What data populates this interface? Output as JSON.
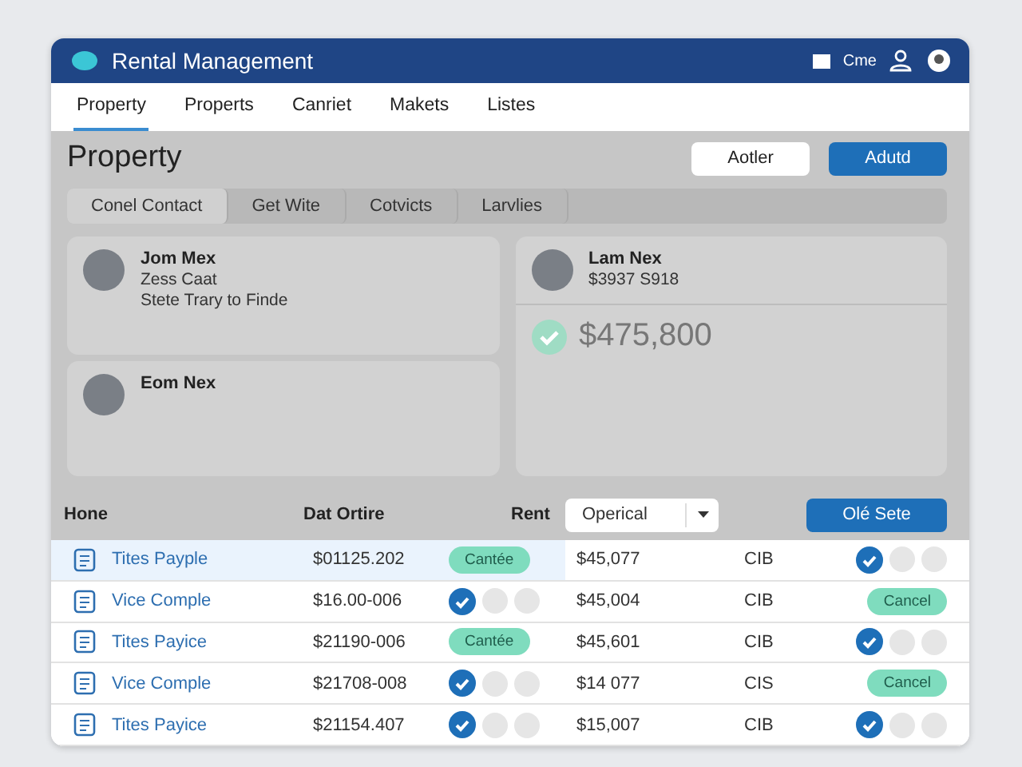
{
  "app": {
    "title": "Rental Management",
    "user_label": "Cme"
  },
  "nav": [
    {
      "label": "Property",
      "selected": true
    },
    {
      "label": "Properts",
      "selected": false
    },
    {
      "label": "Canriet",
      "selected": false
    },
    {
      "label": "Makets",
      "selected": false
    },
    {
      "label": "Listes",
      "selected": false
    }
  ],
  "page": {
    "title": "Property",
    "buttons": [
      {
        "label": "Aotler",
        "kind": "secondary"
      },
      {
        "label": "Adutd",
        "kind": "primary"
      }
    ]
  },
  "subtabs": [
    {
      "label": "Conel Contact",
      "selected": true
    },
    {
      "label": "Get Wite",
      "selected": false
    },
    {
      "label": "Cotvicts",
      "selected": false
    },
    {
      "label": "Larvlies",
      "selected": false
    }
  ],
  "contacts_left": [
    {
      "name": "Jom Mex",
      "lines": [
        "Zess Caat",
        "Stete Trary to Finde"
      ]
    },
    {
      "name": "Eom Nex"
    }
  ],
  "contact_right": {
    "name": "Lam Nex",
    "lines": [
      "$3937 S918"
    ],
    "amount": "$475,800",
    "verified": true
  },
  "table": {
    "columns": [
      "Hone",
      "Dat Ortire",
      "Rent"
    ],
    "filter": {
      "value": "Operical"
    },
    "action": "Olé Sete",
    "rows": [
      {
        "name": "Tites Payple",
        "date": "$01125.202",
        "status": {
          "kind": "pill",
          "label": "Cantée"
        },
        "rent": "$45,077",
        "code": "CIB",
        "end": {
          "kind": "checks",
          "checked": true
        },
        "selected": true
      },
      {
        "name": "Vice Comple",
        "date": "$16.00-006",
        "status": {
          "kind": "checks",
          "checked": true
        },
        "rent": "$45,004",
        "code": "CIB",
        "end": {
          "kind": "pill",
          "label": "Cancel"
        },
        "selected": false
      },
      {
        "name": "Tites Payice",
        "date": "$21190-006",
        "status": {
          "kind": "pill",
          "label": "Cantée"
        },
        "rent": "$45,601",
        "code": "CIB",
        "end": {
          "kind": "checks",
          "checked": true
        },
        "selected": false
      },
      {
        "name": "Vice Comple",
        "date": "$21708-008",
        "status": {
          "kind": "checks",
          "checked": true
        },
        "rent": "$14 077",
        "code": "CIS",
        "end": {
          "kind": "pill",
          "label": "Cancel"
        },
        "selected": false
      },
      {
        "name": "Tites Payice",
        "date": "$21154.407",
        "status": {
          "kind": "checks",
          "checked": true
        },
        "rent": "$15,007",
        "code": "CIB",
        "end": {
          "kind": "checks",
          "checked": true
        },
        "selected": false
      }
    ]
  }
}
